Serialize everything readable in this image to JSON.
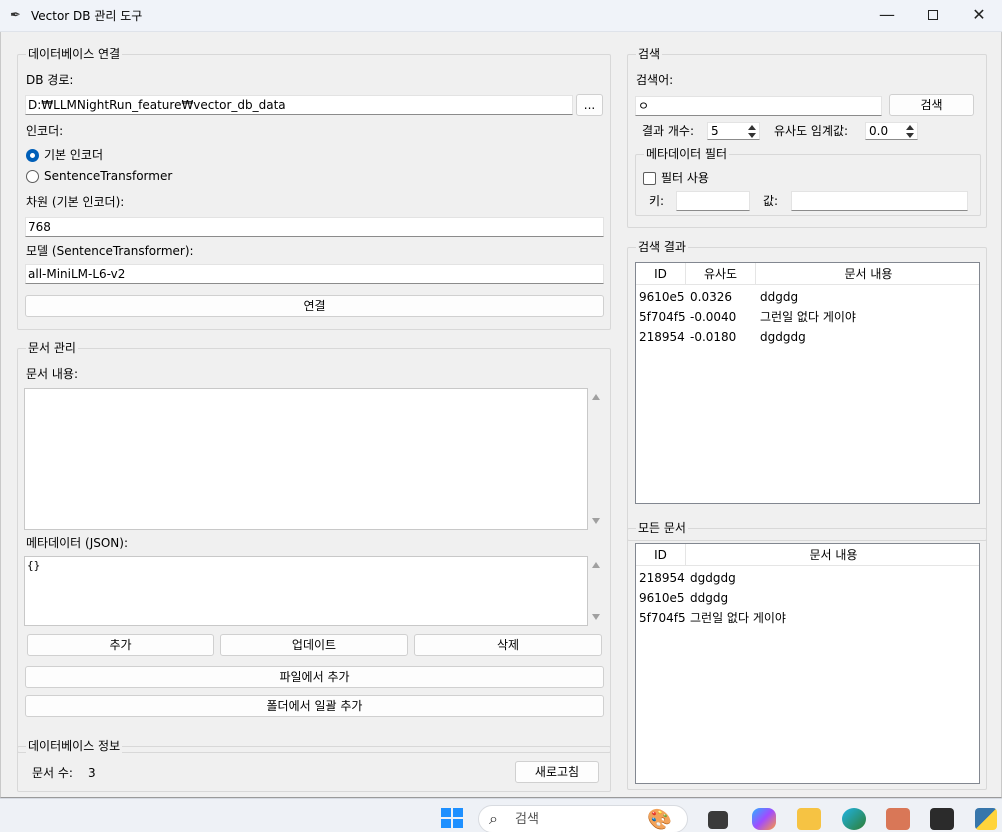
{
  "window": {
    "title": "Vector DB 관리 도구",
    "minimize": "—",
    "close": "✕"
  },
  "db_connection": {
    "group_title": "데이터베이스 연결",
    "path_label": "DB 경로:",
    "path_value": "D:₩LLMNightRun_feature₩vector_db_data",
    "browse_label": "...",
    "encoder_label": "인코더:",
    "encoder_options": [
      "기본 인코더",
      "SentenceTransformer"
    ],
    "encoder_selected": "기본 인코더",
    "dimension_label": "차원 (기본 인코더):",
    "dimension_value": "768",
    "model_label": "모델 (SentenceTransformer):",
    "model_value": "all-MiniLM-L6-v2",
    "connect_label": "연결"
  },
  "doc_management": {
    "group_title": "문서 관리",
    "content_label": "문서 내용:",
    "content_value": "",
    "metadata_label": "메타데이터 (JSON):",
    "metadata_value": "{}",
    "add_label": "추가",
    "update_label": "업데이트",
    "delete_label": "삭제",
    "add_file_label": "파일에서 추가",
    "add_folder_label": "폴더에서 일괄 추가"
  },
  "db_info": {
    "group_title": "데이터베이스 정보",
    "doc_count_label": "문서 수:",
    "doc_count_value": "3",
    "refresh_label": "새로고침"
  },
  "search": {
    "group_title": "검색",
    "query_label": "검색어:",
    "query_value": "ㅇ",
    "search_button": "검색",
    "result_count_label": "결과 개수:",
    "result_count_value": "5",
    "threshold_label": "유사도 임계값:",
    "threshold_value": "0.0",
    "filter_group_title": "메타데이터 필터",
    "use_filter_label": "필터 사용",
    "use_filter_checked": false,
    "key_label": "키:",
    "key_value": "",
    "value_label": "값:",
    "value_value": ""
  },
  "search_results": {
    "group_title": "검색 결과",
    "columns": [
      "ID",
      "유사도",
      "문서 내용"
    ],
    "rows": [
      {
        "id": "9610e5",
        "score": "0.0326",
        "content": "ddgdg"
      },
      {
        "id": "5f704f5",
        "score": "-0.0040",
        "content": "그런일 없다 게이야"
      },
      {
        "id": "218954",
        "score": "-0.0180",
        "content": "dgdgdg"
      }
    ]
  },
  "all_docs": {
    "group_title": "모든 문서",
    "columns": [
      "ID",
      "문서 내용"
    ],
    "rows": [
      {
        "id": "218954",
        "content": "dgdgdg"
      },
      {
        "id": "9610e5",
        "content": "ddgdg"
      },
      {
        "id": "5f704f5",
        "content": "그런일 없다 게이야"
      }
    ]
  },
  "taskbar": {
    "search_placeholder": "검색",
    "icons": [
      "windows-start-icon",
      "search-icon",
      "palette-icon",
      "task-view-icon",
      "copilot-icon",
      "file-explorer-icon",
      "edge-icon",
      "claude-icon",
      "terminal-icon",
      "python-icon"
    ]
  },
  "colors": {
    "accent": "#005fb8",
    "window_bg": "#f0f0f0",
    "titlebar_bg": "#f0f3f9"
  }
}
